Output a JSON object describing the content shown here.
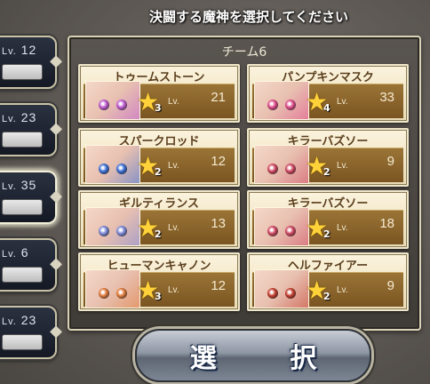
{
  "heading": "決闘する魔神を選択してください",
  "left_teams": [
    {
      "lv_prefix": "Lv.",
      "level": "12",
      "selected": false
    },
    {
      "lv_prefix": "Lv.",
      "level": "23",
      "selected": false
    },
    {
      "lv_prefix": "Lv.",
      "level": "35",
      "selected": true
    },
    {
      "lv_prefix": "Lv.",
      "level": "6",
      "selected": false
    },
    {
      "lv_prefix": "Lv.",
      "level": "23",
      "selected": false
    }
  ],
  "panel": {
    "team_name": "チーム6",
    "slots": [
      {
        "name": "トゥームストーン",
        "rarity": "3",
        "lv_label": "Lv.",
        "level": "21",
        "eye_color": "#c05bd0"
      },
      {
        "name": "パンプキンマスク",
        "rarity": "4",
        "lv_label": "Lv.",
        "level": "33",
        "eye_color": "#e04b8a"
      },
      {
        "name": "スパークロッド",
        "rarity": "2",
        "lv_label": "Lv.",
        "level": "12",
        "eye_color": "#3c6fd6"
      },
      {
        "name": "キラーバズソー",
        "rarity": "2",
        "lv_label": "Lv.",
        "level": "9",
        "eye_color": "#d04660"
      },
      {
        "name": "ギルティランス",
        "rarity": "2",
        "lv_label": "Lv.",
        "level": "13",
        "eye_color": "#7d88d8"
      },
      {
        "name": "キラーバズソー",
        "rarity": "2",
        "lv_label": "Lv.",
        "level": "18",
        "eye_color": "#d04660"
      },
      {
        "name": "ヒューマンキャノン",
        "rarity": "3",
        "lv_label": "Lv.",
        "level": "12",
        "eye_color": "#e07a3a"
      },
      {
        "name": "ヘルファイアー",
        "rarity": "2",
        "lv_label": "Lv.",
        "level": "9",
        "eye_color": "#c23c2c"
      }
    ]
  },
  "select_button": "選 択",
  "colors": {
    "panel_border": "#d8d2b6",
    "card_bg": "#fbf3dd",
    "card_lower": "#8a6329",
    "star": "#ffd23a"
  }
}
